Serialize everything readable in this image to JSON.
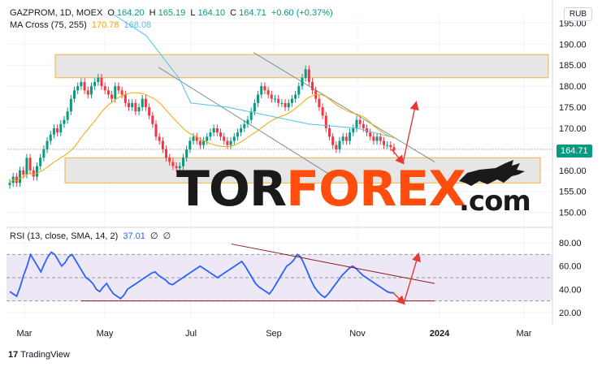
{
  "header": {
    "symbol": "GAZPROM, 1D, MOEX",
    "ohlc": [
      {
        "k": "O",
        "v": "164.20"
      },
      {
        "k": "H",
        "v": "165.19"
      },
      {
        "k": "L",
        "v": "164.10"
      },
      {
        "k": "C",
        "v": "164.71"
      }
    ],
    "change": "+0.60 (+0.37%)",
    "ma_label": "MA Cross (75, 255)",
    "ma_fast": "170.78",
    "ma_slow": "168.08",
    "currency": "RUB",
    "last_price": "164.71"
  },
  "rsi_legend": {
    "label": "RSI (13, close, SMA, 14, 2)",
    "value": "37.01",
    "icons": [
      "∅",
      "∅"
    ]
  },
  "footer": {
    "logo": "17",
    "brand": "TradingView"
  },
  "watermark": {
    "part1": "TOR",
    "part2": "FOREX",
    "part3": ".com"
  },
  "colors": {
    "up": "#089981",
    "down": "#f23645",
    "ma_fast": "#f7a600",
    "ma_slow": "#4fc3e8",
    "rsi": "#2962ff",
    "rsi_band": "#ede7f6",
    "channel": "#78909c",
    "zone_fill": "#e0e0e0",
    "zone_border": "#f5b041",
    "arrow": "#e53935",
    "trend_rsi": "#8b1a1a"
  },
  "chart_data": [
    {
      "type": "candlestick",
      "title": "GAZPROM, 1D, MOEX",
      "y_ticks": [
        150,
        155,
        160,
        165,
        170,
        175,
        180,
        185,
        190,
        195
      ],
      "ylim": [
        148,
        197
      ],
      "x_ticks": [
        "Mar",
        "May",
        "Jul",
        "Sep",
        "Nov",
        "2024",
        "Mar"
      ],
      "closes": [
        157,
        158.5,
        157,
        160,
        159,
        163,
        160,
        158.5,
        161,
        163,
        165,
        167,
        168.5,
        170,
        169,
        171,
        172,
        174,
        177,
        179,
        180,
        181,
        179,
        178,
        180,
        181,
        182,
        180,
        179,
        178,
        177,
        180,
        179,
        178,
        176,
        175,
        176,
        174,
        175,
        177,
        175,
        173,
        171,
        168,
        167,
        165,
        163,
        162,
        161,
        160.5,
        161,
        163,
        165,
        167,
        168,
        167,
        166,
        167,
        168,
        169,
        170,
        169,
        168,
        167,
        166,
        167,
        168,
        169,
        170,
        171,
        172,
        174,
        176,
        178,
        180,
        179,
        178,
        177,
        177,
        176,
        176,
        175,
        176,
        177,
        178,
        180,
        182,
        184,
        181,
        179,
        177,
        175,
        173,
        170,
        168,
        166,
        165,
        167,
        168,
        167,
        169,
        170,
        172,
        171,
        170,
        169,
        168,
        167,
        168,
        167,
        166,
        166,
        165.5,
        164.71
      ],
      "annotations": [
        "resistance zone 182.5–187.5",
        "support zone 157–163",
        "descending channel",
        "price arrows: dip to ~162 then rise to ~176"
      ]
    },
    {
      "type": "line",
      "name": "RSI",
      "y_ticks": [
        20,
        40,
        60,
        80
      ],
      "ylim": [
        15,
        85
      ],
      "band": [
        30,
        70
      ],
      "midline": 50,
      "values": [
        38,
        36,
        34,
        42,
        52,
        60,
        70,
        65,
        60,
        55,
        62,
        68,
        72,
        70,
        65,
        60,
        63,
        68,
        70,
        65,
        60,
        55,
        50,
        48,
        45,
        40,
        38,
        42,
        45,
        40,
        36,
        34,
        32,
        35,
        40,
        42,
        44,
        46,
        48,
        50,
        52,
        54,
        55,
        52,
        50,
        48,
        45,
        44,
        46,
        48,
        50,
        52,
        54,
        56,
        58,
        60,
        58,
        56,
        54,
        52,
        50,
        52,
        54,
        56,
        58,
        60,
        62,
        64,
        60,
        55,
        50,
        45,
        42,
        40,
        38,
        36,
        40,
        45,
        50,
        55,
        60,
        62,
        65,
        70,
        68,
        62,
        55,
        48,
        42,
        38,
        35,
        33,
        36,
        40,
        44,
        48,
        52,
        55,
        58,
        60,
        58,
        55,
        52,
        50,
        48,
        46,
        44,
        42,
        40,
        38,
        37,
        37.01
      ],
      "annotations": [
        "falling RSI trendline",
        "support line near 30",
        "arrows: dip to ~28 then rise to ~70"
      ]
    }
  ]
}
